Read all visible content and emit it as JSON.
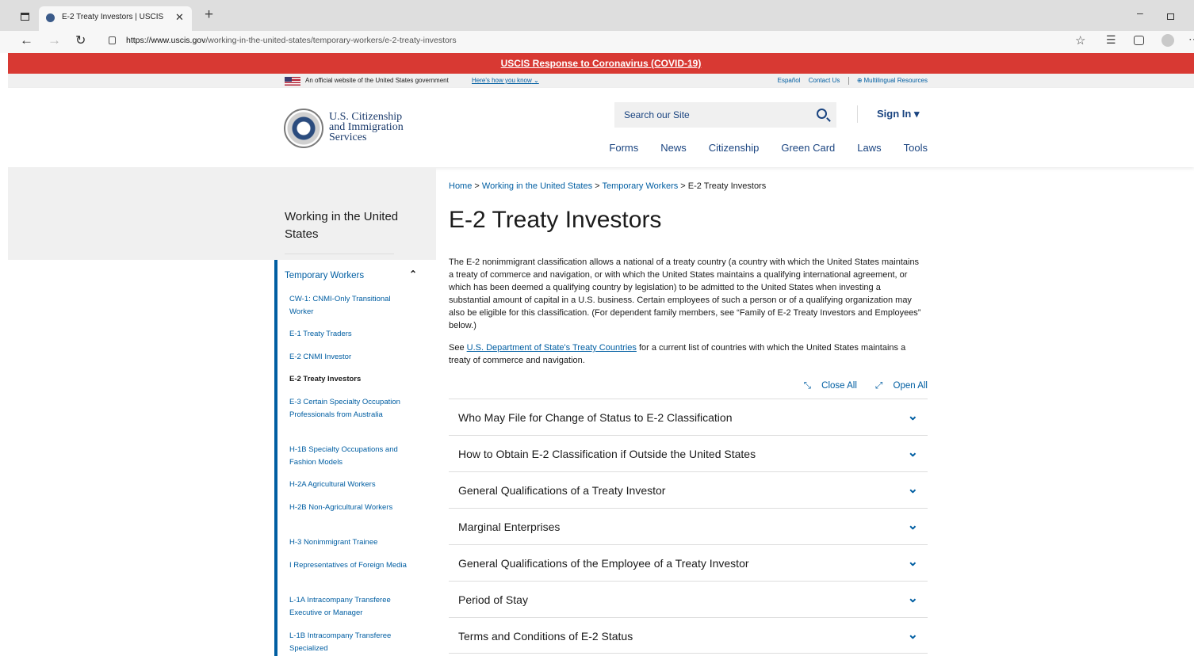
{
  "browser": {
    "tab_title": "E-2 Treaty Investors | USCIS",
    "url_host": "https://www.uscis.gov",
    "url_path": "/working-in-the-united-states/temporary-workers/e-2-treaty-investors"
  },
  "alert": {
    "link": "USCIS Response to Coronavirus (COVID-19)"
  },
  "govbar": {
    "text": "An official website of the United States government",
    "heres_how": "Here's how you know",
    "espanol": "Español",
    "contact": "Contact Us",
    "multilingual": "Multilingual Resources"
  },
  "header": {
    "logo_line1": "U.S. Citizenship",
    "logo_line2": "and Immigration",
    "logo_line3": "Services",
    "search_placeholder": "Search our Site",
    "signin": "Sign In ▾",
    "nav": [
      "Forms",
      "News",
      "Citizenship",
      "Green Card",
      "Laws",
      "Tools"
    ]
  },
  "sidebar": {
    "title": "Working in the United States",
    "section": "Temporary Workers",
    "items": [
      "CW-1: CNMI-Only Transitional Worker",
      "E-1 Treaty Traders",
      "E-2 CNMI Investor",
      "E-2 Treaty Investors",
      "E-3 Certain Specialty Occupation Professionals from Australia",
      "H-1B Specialty Occupations and Fashion Models",
      "H-2A Agricultural Workers",
      "H-2B Non-Agricultural Workers",
      "H-3 Nonimmigrant Trainee",
      "I Representatives of Foreign Media",
      "L-1A Intracompany Transferee Executive or Manager",
      "L-1B Intracompany Transferee Specialized"
    ]
  },
  "breadcrumb": {
    "home": "Home",
    "sep": ">",
    "working": "Working in the United States",
    "temp": "Temporary Workers",
    "current": "E-2 Treaty Investors"
  },
  "main": {
    "title": "E-2 Treaty Investors",
    "intro": "The E-2 nonimmigrant classification allows a national of a treaty country (a country with which the United States maintains a treaty of commerce and navigation, or with which the United States maintains a qualifying international agreement, or which has been deemed a qualifying country by legislation) to be admitted to the United States when investing a substantial amount of capital in a U.S. business. Certain employees of such a person or of a qualifying organization may also be eligible for this classification. (For dependent family members, see “Family of E-2 Treaty Investors and Employees” below.)",
    "see_prefix": "See",
    "see_link": "U.S. Department of State's Treaty Countries",
    "see_suffix": "for a current list of countries with which the United States maintains a treaty of commerce and navigation.",
    "close_all": "Close All",
    "open_all": "Open All",
    "accordions": [
      "Who May File for Change of Status to E-2 Classification",
      "How to Obtain E-2 Classification if Outside the United States",
      "General Qualifications of a Treaty Investor",
      "Marginal Enterprises",
      "General Qualifications of the Employee of a Treaty Investor",
      "Period of Stay",
      "Terms and Conditions of E-2 Status"
    ]
  }
}
